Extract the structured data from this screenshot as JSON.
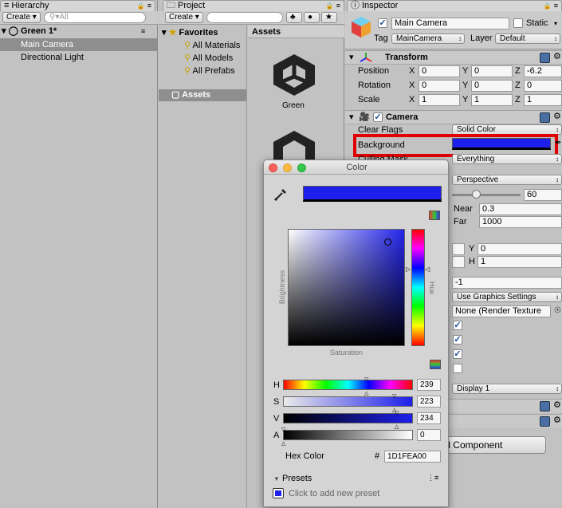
{
  "hierarchy": {
    "tab": "Hierarchy",
    "create": "Create",
    "search_placeholder": "All",
    "scene": "Green 1*",
    "items": [
      "Main Camera",
      "Directional Light"
    ]
  },
  "project": {
    "tab": "Project",
    "create": "Create",
    "favorites": "Favorites",
    "fav_items": [
      "All Materials",
      "All Models",
      "All Prefabs"
    ],
    "assets_folder": "Assets",
    "assets_header": "Assets",
    "asset_items": [
      "Green"
    ]
  },
  "inspector": {
    "tab": "Inspector",
    "object_name": "Main Camera",
    "static_label": "Static",
    "tag_label": "Tag",
    "tag_value": "MainCamera",
    "layer_label": "Layer",
    "layer_value": "Default",
    "transform": {
      "title": "Transform",
      "rows": [
        {
          "label": "Position",
          "x": "0",
          "y": "0",
          "z": "-6.2"
        },
        {
          "label": "Rotation",
          "x": "0",
          "y": "0",
          "z": "0"
        },
        {
          "label": "Scale",
          "x": "1",
          "y": "1",
          "z": "1"
        }
      ]
    },
    "camera": {
      "title": "Camera",
      "clear_flags_label": "Clear Flags",
      "clear_flags_value": "Solid Color",
      "background_label": "Background",
      "background_color": "#1D1FEA",
      "culling_label": "Culling Mask",
      "culling_value": "Everything",
      "projection_value": "Perspective",
      "fov_value": "60",
      "near_label": "Near",
      "near_value": "0.3",
      "far_label": "Far",
      "far_value": "1000",
      "y_label": "Y",
      "y_value": "0",
      "h_label": "H",
      "h_value": "1",
      "depth_value": "-1",
      "rendering_value": "Use Graphics Settings",
      "target_value": "None (Render Texture",
      "display_value": "Display 1"
    },
    "add_component": "Add Component"
  },
  "color_picker": {
    "title": "Color",
    "brightness": "Brightness",
    "saturation": "Saturation",
    "hue": "Hue",
    "h_label": "H",
    "h_value": "239",
    "s_label": "S",
    "s_value": "223",
    "v_label": "V",
    "v_value": "234",
    "a_label": "A",
    "a_value": "0",
    "hex_label": "Hex Color",
    "hex_hash": "#",
    "hex_value": "1D1FEA00",
    "presets": "Presets",
    "presets_hint": "Click to add new preset",
    "swatch_color": "#1D1FEA",
    "highlight_color": "#EE0000"
  }
}
